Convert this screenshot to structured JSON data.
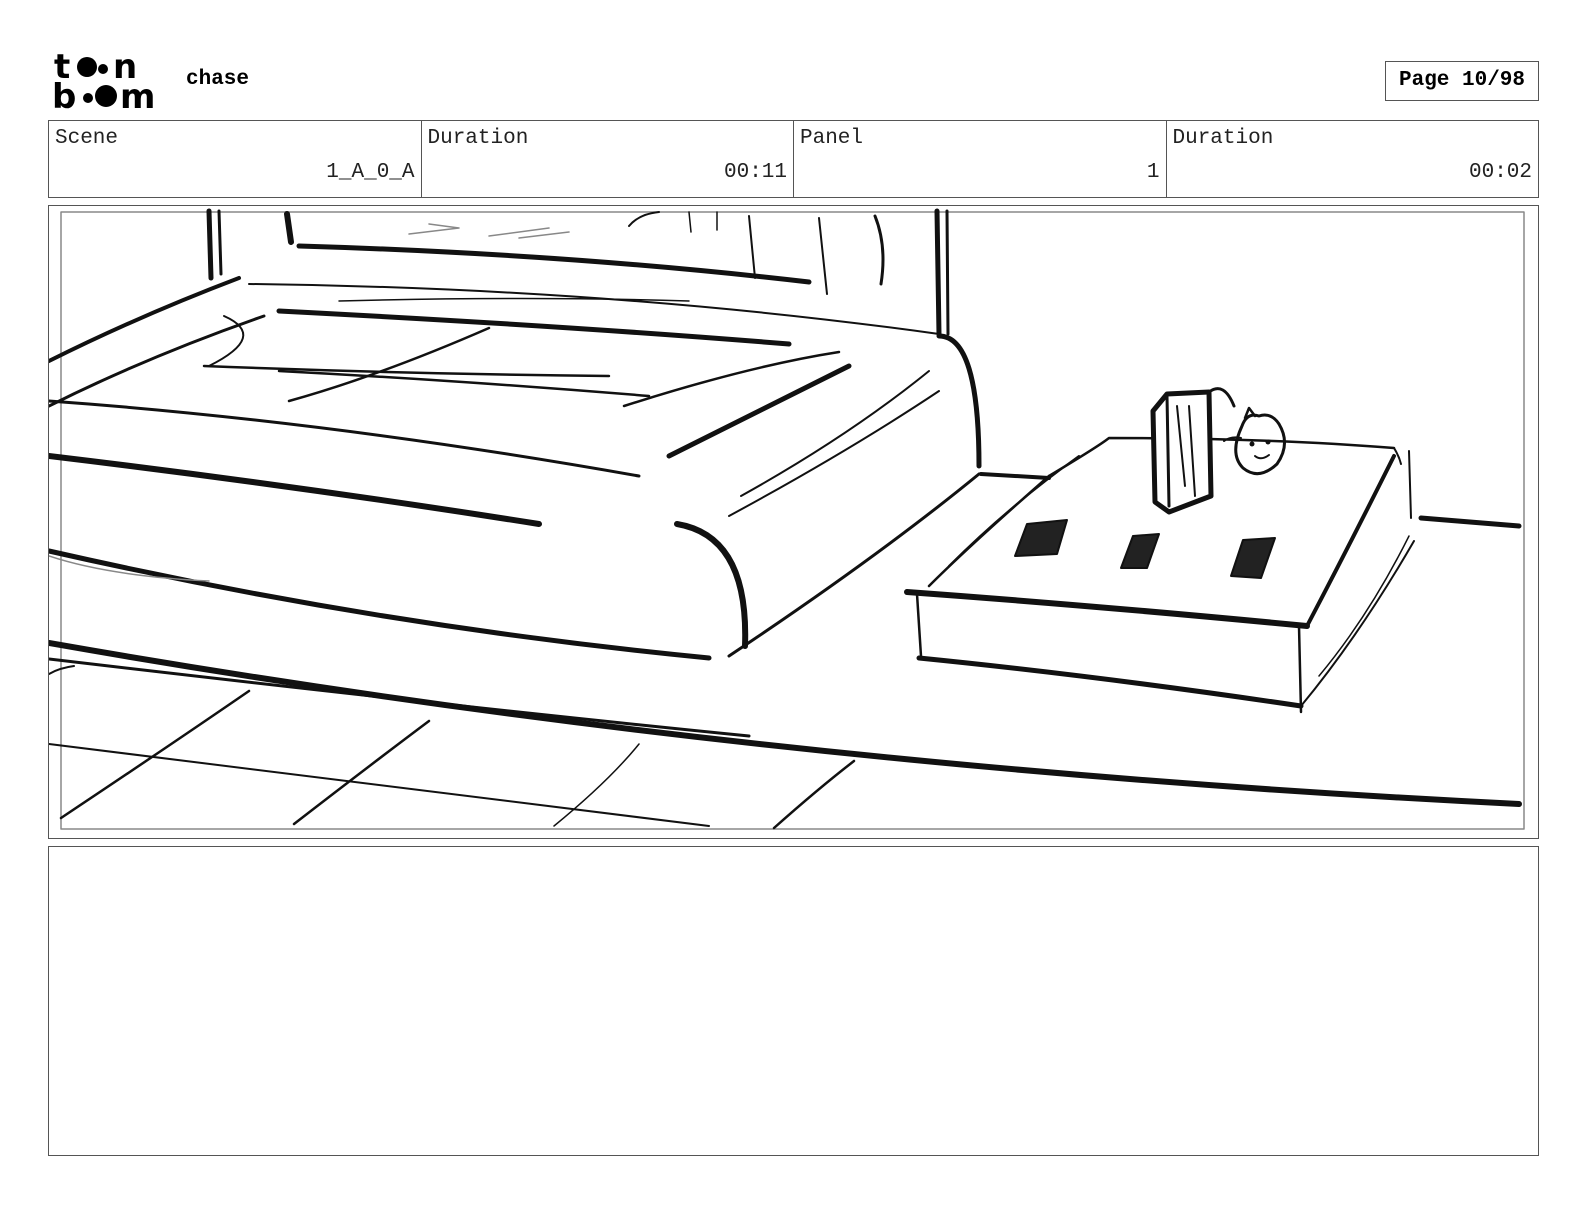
{
  "header": {
    "logo_line1": "t••n",
    "logo_line2": "b••m",
    "project_title": "chase",
    "page_label": "Page 10/98"
  },
  "info": {
    "scene_label": "Scene",
    "scene_value": "1_A_0_A",
    "scene_duration_label": "Duration",
    "scene_duration_value": "00:11",
    "panel_label": "Panel",
    "panel_value": "1",
    "panel_duration_label": "Duration",
    "panel_duration_value": "00:02"
  },
  "notes": {
    "text": ""
  }
}
